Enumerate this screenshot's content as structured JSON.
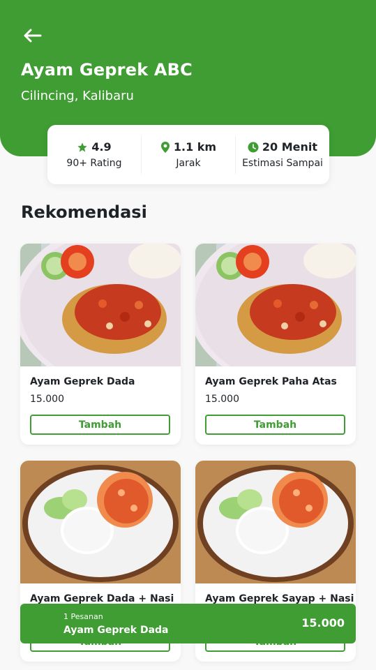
{
  "header": {
    "back_icon": "arrow-left-icon",
    "title": "Ayam Geprek ABC",
    "subtitle": "Cilincing, Kalibaru"
  },
  "stats": [
    {
      "icon": "star-icon",
      "value": "4.9",
      "label": "90+ Rating"
    },
    {
      "icon": "map-pin-icon",
      "value": "1.1 km",
      "label": "Jarak"
    },
    {
      "icon": "clock-icon",
      "value": "20 Menit",
      "label": "Estimasi Sampai"
    }
  ],
  "section": {
    "title": "Rekomendasi"
  },
  "products": [
    {
      "name": "Ayam Geprek Dada",
      "price": "15.000",
      "button": "Tambah"
    },
    {
      "name": "Ayam Geprek Paha Atas",
      "price": "15.000",
      "button": "Tambah"
    },
    {
      "name": "Ayam Geprek Dada + Nasi",
      "price": "",
      "button": "Tambah"
    },
    {
      "name": "Ayam Geprek Sayap + Nasi",
      "price": "",
      "button": "Tambah"
    }
  ],
  "cart": {
    "count": "1 Pesanan",
    "item": "Ayam Geprek Dada",
    "total": "15.000"
  },
  "colors": {
    "primary": "#3f9d33",
    "background": "#f8f8f8",
    "text": "#1f2328"
  }
}
